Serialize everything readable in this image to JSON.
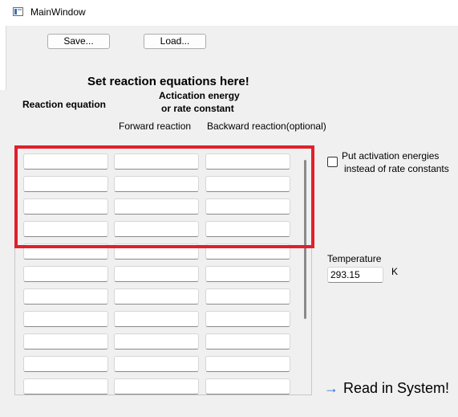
{
  "window": {
    "title": "MainWindow"
  },
  "toolbar": {
    "save_label": "Save...",
    "load_label": "Load..."
  },
  "section": {
    "title": "Set reaction equations here!",
    "reaction_equation_header": "Reaction equation",
    "activation_header_line1": "Actication energy",
    "activation_header_line2": "or rate constant",
    "forward_header": "Forward reaction",
    "backward_header": "Backward reaction(optional)"
  },
  "table": {
    "rows": [
      [
        "",
        "",
        ""
      ],
      [
        "",
        "",
        ""
      ],
      [
        "",
        "",
        ""
      ],
      [
        "",
        "",
        ""
      ],
      [
        "",
        "",
        ""
      ],
      [
        "",
        "",
        ""
      ],
      [
        "",
        "",
        ""
      ],
      [
        "",
        "",
        ""
      ],
      [
        "",
        "",
        ""
      ],
      [
        "",
        "",
        ""
      ],
      [
        "",
        "",
        ""
      ]
    ]
  },
  "options": {
    "activation_checkbox_line1": "Put activation energies",
    "activation_checkbox_line2": "instead of rate constants",
    "activation_checked": false
  },
  "temperature": {
    "label": "Temperature",
    "value": "293.15",
    "unit": "K"
  },
  "action": {
    "read_label": "Read in System!",
    "icon": "arrow-right-icon"
  },
  "colors": {
    "highlight": "#e0202c",
    "accent": "#1f6bd1",
    "background": "#f0f0f0"
  }
}
